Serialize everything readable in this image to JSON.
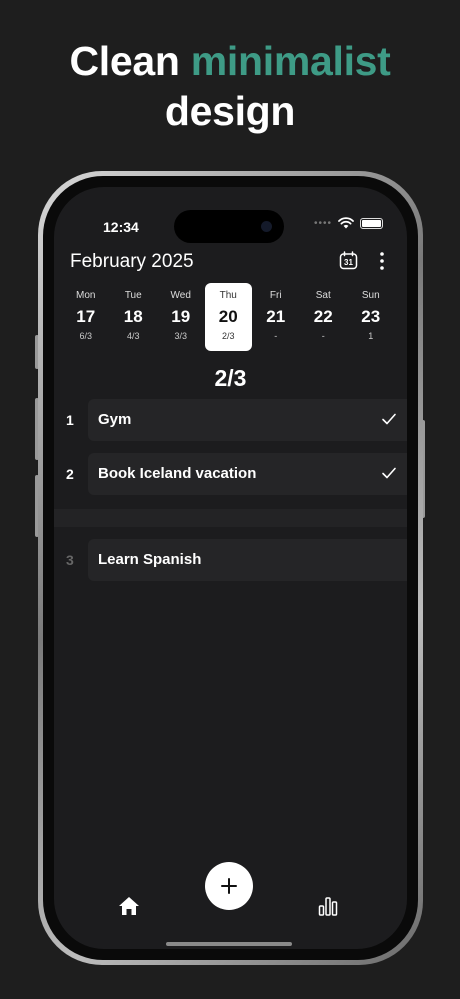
{
  "headline": {
    "part1": "Clean",
    "accent": "minimalist",
    "part2": "design"
  },
  "status_bar": {
    "time": "12:34",
    "dots": "••••"
  },
  "header": {
    "month": "February 2025",
    "calendar_day": "31"
  },
  "week": [
    {
      "name": "Mon",
      "num": "17",
      "score": "6/3",
      "selected": false
    },
    {
      "name": "Tue",
      "num": "18",
      "score": "4/3",
      "selected": false
    },
    {
      "name": "Wed",
      "num": "19",
      "score": "3/3",
      "selected": false
    },
    {
      "name": "Thu",
      "num": "20",
      "score": "2/3",
      "selected": true
    },
    {
      "name": "Fri",
      "num": "21",
      "score": "-",
      "selected": false
    },
    {
      "name": "Sat",
      "num": "22",
      "score": "-",
      "selected": false
    },
    {
      "name": "Sun",
      "num": "23",
      "score": "1",
      "selected": false
    }
  ],
  "summary": "2/3",
  "tasks": [
    {
      "index": "1",
      "label": "Gym",
      "done": true
    },
    {
      "index": "2",
      "label": "Book Iceland vacation",
      "done": true
    },
    {
      "index": "3",
      "label": "Learn Spanish",
      "done": false
    }
  ],
  "colors": {
    "accent": "#3e9b86",
    "background": "#1e1e1e",
    "screen": "#1c1c1e",
    "task_box": "#252527"
  },
  "icons": [
    "calendar-icon",
    "more-vertical-icon",
    "check-icon",
    "plus-icon",
    "home-icon",
    "bar-chart-icon",
    "wifi-icon",
    "battery-icon"
  ]
}
